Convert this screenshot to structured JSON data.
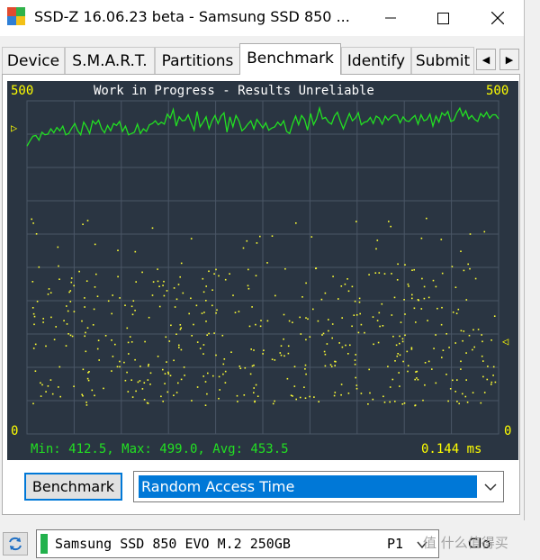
{
  "window": {
    "title": "SSD-Z 16.06.23 beta - Samsung SSD 850 ...",
    "icon": "ssdz-app-icon",
    "controls": {
      "minimize": "minimize-icon",
      "maximize": "maximize-icon",
      "close": "close-icon"
    }
  },
  "tabs": [
    {
      "label": "Device",
      "active": false
    },
    {
      "label": "S.M.A.R.T.",
      "active": false
    },
    {
      "label": "Partitions",
      "active": false
    },
    {
      "label": "Benchmark",
      "active": true
    },
    {
      "label": "Identify",
      "active": false
    },
    {
      "label": "Submit",
      "active": false
    }
  ],
  "tab_scroll": {
    "left": "◀",
    "right": "▶"
  },
  "graph": {
    "top_left_value": "500",
    "top_right_value": "500",
    "bottom_left_value": "0",
    "bottom_right_value": "0",
    "status": "Work in Progress - Results Unreliable",
    "stats_text": "Min: 412.5, Max: 499.0, Avg: 453.5",
    "result_text": "0.144 ms",
    "left_marker": "▷",
    "right_marker": "◁",
    "colors": {
      "background": "#2a3542",
      "grid": "#4a5666",
      "line": "#22e022",
      "dots": "#ffff33",
      "labels": "#ffff00"
    }
  },
  "chart_data": {
    "type": "line",
    "ylim": [
      0,
      500
    ],
    "series": [
      {
        "values": [
          432,
          440,
          447,
          448,
          441,
          453,
          449,
          450,
          458,
          452,
          460,
          455,
          462,
          449,
          451,
          459,
          466,
          455,
          449,
          468,
          461,
          451,
          470,
          465,
          471,
          458,
          452,
          463,
          455,
          466,
          463,
          469,
          454,
          462,
          449,
          451,
          453,
          465,
          451,
          458,
          454,
          464,
          466,
          470,
          464,
          468,
          465,
          480,
          474,
          487,
          462,
          476,
          470,
          471,
          479,
          467,
          456,
          484,
          461,
          468,
          476,
          458,
          470,
          478,
          466,
          477,
          482,
          453,
          476,
          461,
          478,
          470,
          455,
          459,
          465,
          470,
          458,
          472,
          466,
          459,
          467,
          456,
          459,
          461,
          468,
          463,
          470,
          454,
          451,
          466,
          477,
          464,
          478,
          472,
          456,
          481,
          464,
          473,
          489,
          473,
          475,
          468,
          465,
          477,
          483,
          469,
          458,
          470,
          481,
          470,
          474,
          482,
          464,
          468,
          469,
          475,
          466,
          477,
          474,
          465,
          477,
          471,
          476,
          479,
          478,
          467,
          476,
          470,
          469,
          474,
          478,
          465,
          479,
          470,
          472,
          480,
          462,
          477,
          468,
          482,
          478,
          484,
          469,
          471,
          482,
          489,
          477,
          485,
          473,
          478,
          472,
          469,
          481,
          476,
          483,
          474,
          479,
          479,
          473
        ]
      }
    ]
  },
  "controls": {
    "benchmark_button": "Benchmark",
    "mode_selected": "Random Access Time"
  },
  "statusbar": {
    "drive_name": "Samsung SSD 850 EVO M.2 250GB",
    "partition": "P1",
    "close_label": "Clo",
    "watermark": "值 什么值得买"
  }
}
